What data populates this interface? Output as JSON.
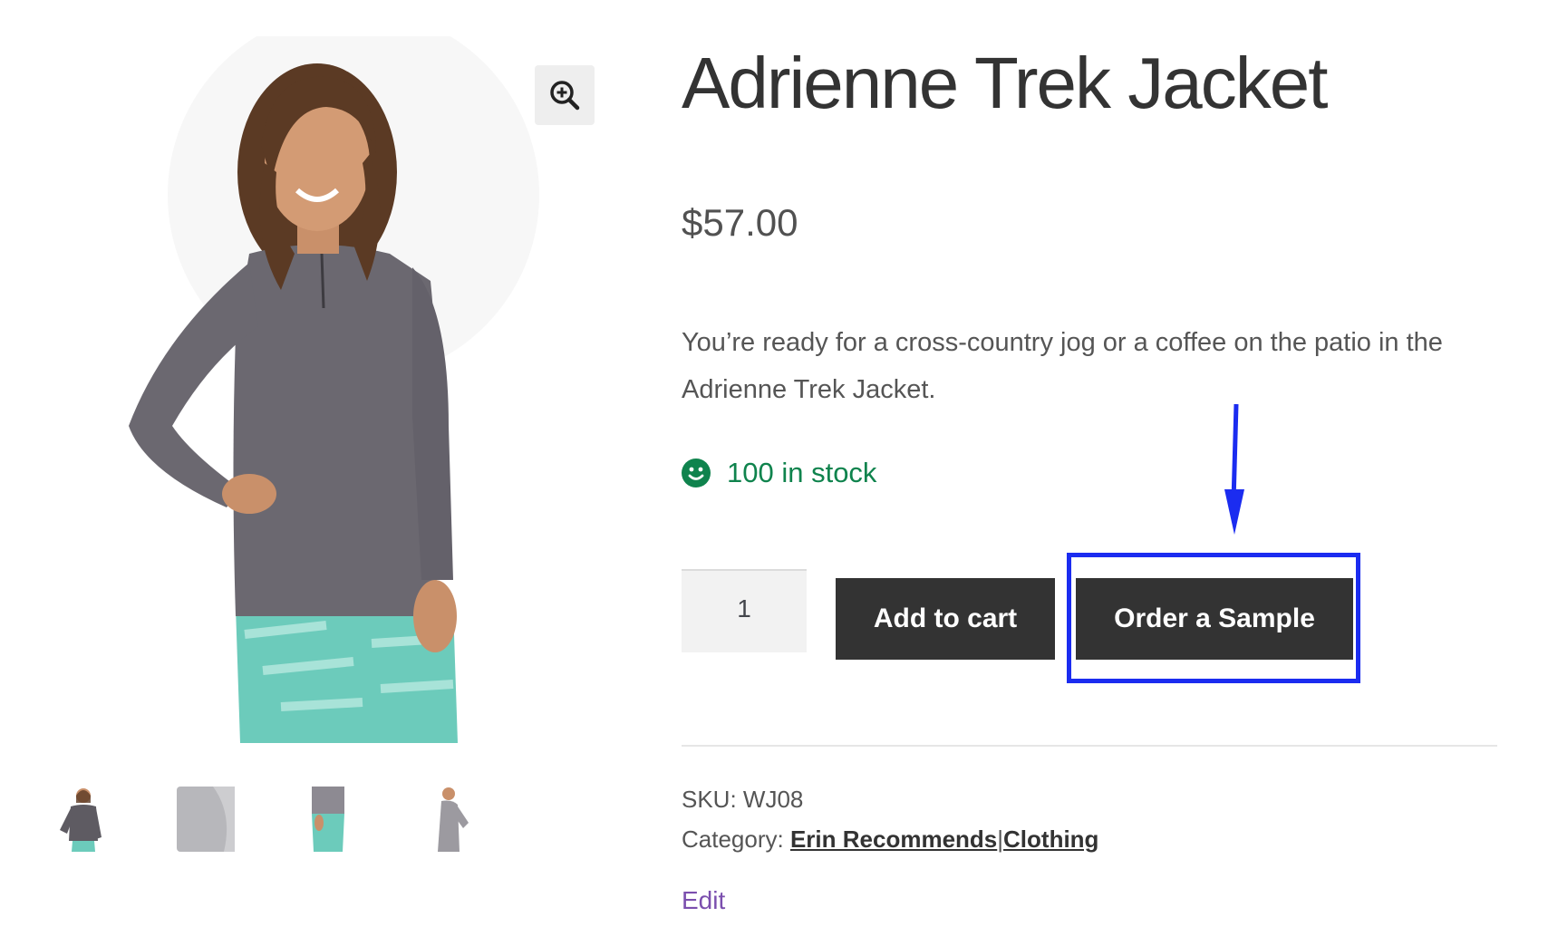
{
  "product": {
    "title": "Adrienne Trek Jacket",
    "price": "$57.00",
    "description": "You’re ready for a cross-country jog or a coffee on the patio in the Adrienne Trek Jacket.",
    "stock_text": "100 in stock"
  },
  "gallery": {
    "zoom_icon": "magnifier-plus-icon",
    "thumbnails": [
      "front-thumbnail",
      "back-thumbnail",
      "side-thumbnail",
      "profile-thumbnail"
    ]
  },
  "cart": {
    "quantity": "1",
    "add_to_cart_label": "Add to cart",
    "order_sample_label": "Order a Sample"
  },
  "meta": {
    "sku_label": "SKU:",
    "sku_value": "WJ08",
    "category_label": "Category:",
    "category_1": "Erin Recommends",
    "separator": "|",
    "category_2": "Clothing"
  },
  "admin": {
    "edit_label": "Edit"
  },
  "colors": {
    "button_bg": "#333333",
    "stock_green": "#0f834d",
    "annotation_blue": "#1b2cf0",
    "edit_purple": "#7b4fae"
  }
}
